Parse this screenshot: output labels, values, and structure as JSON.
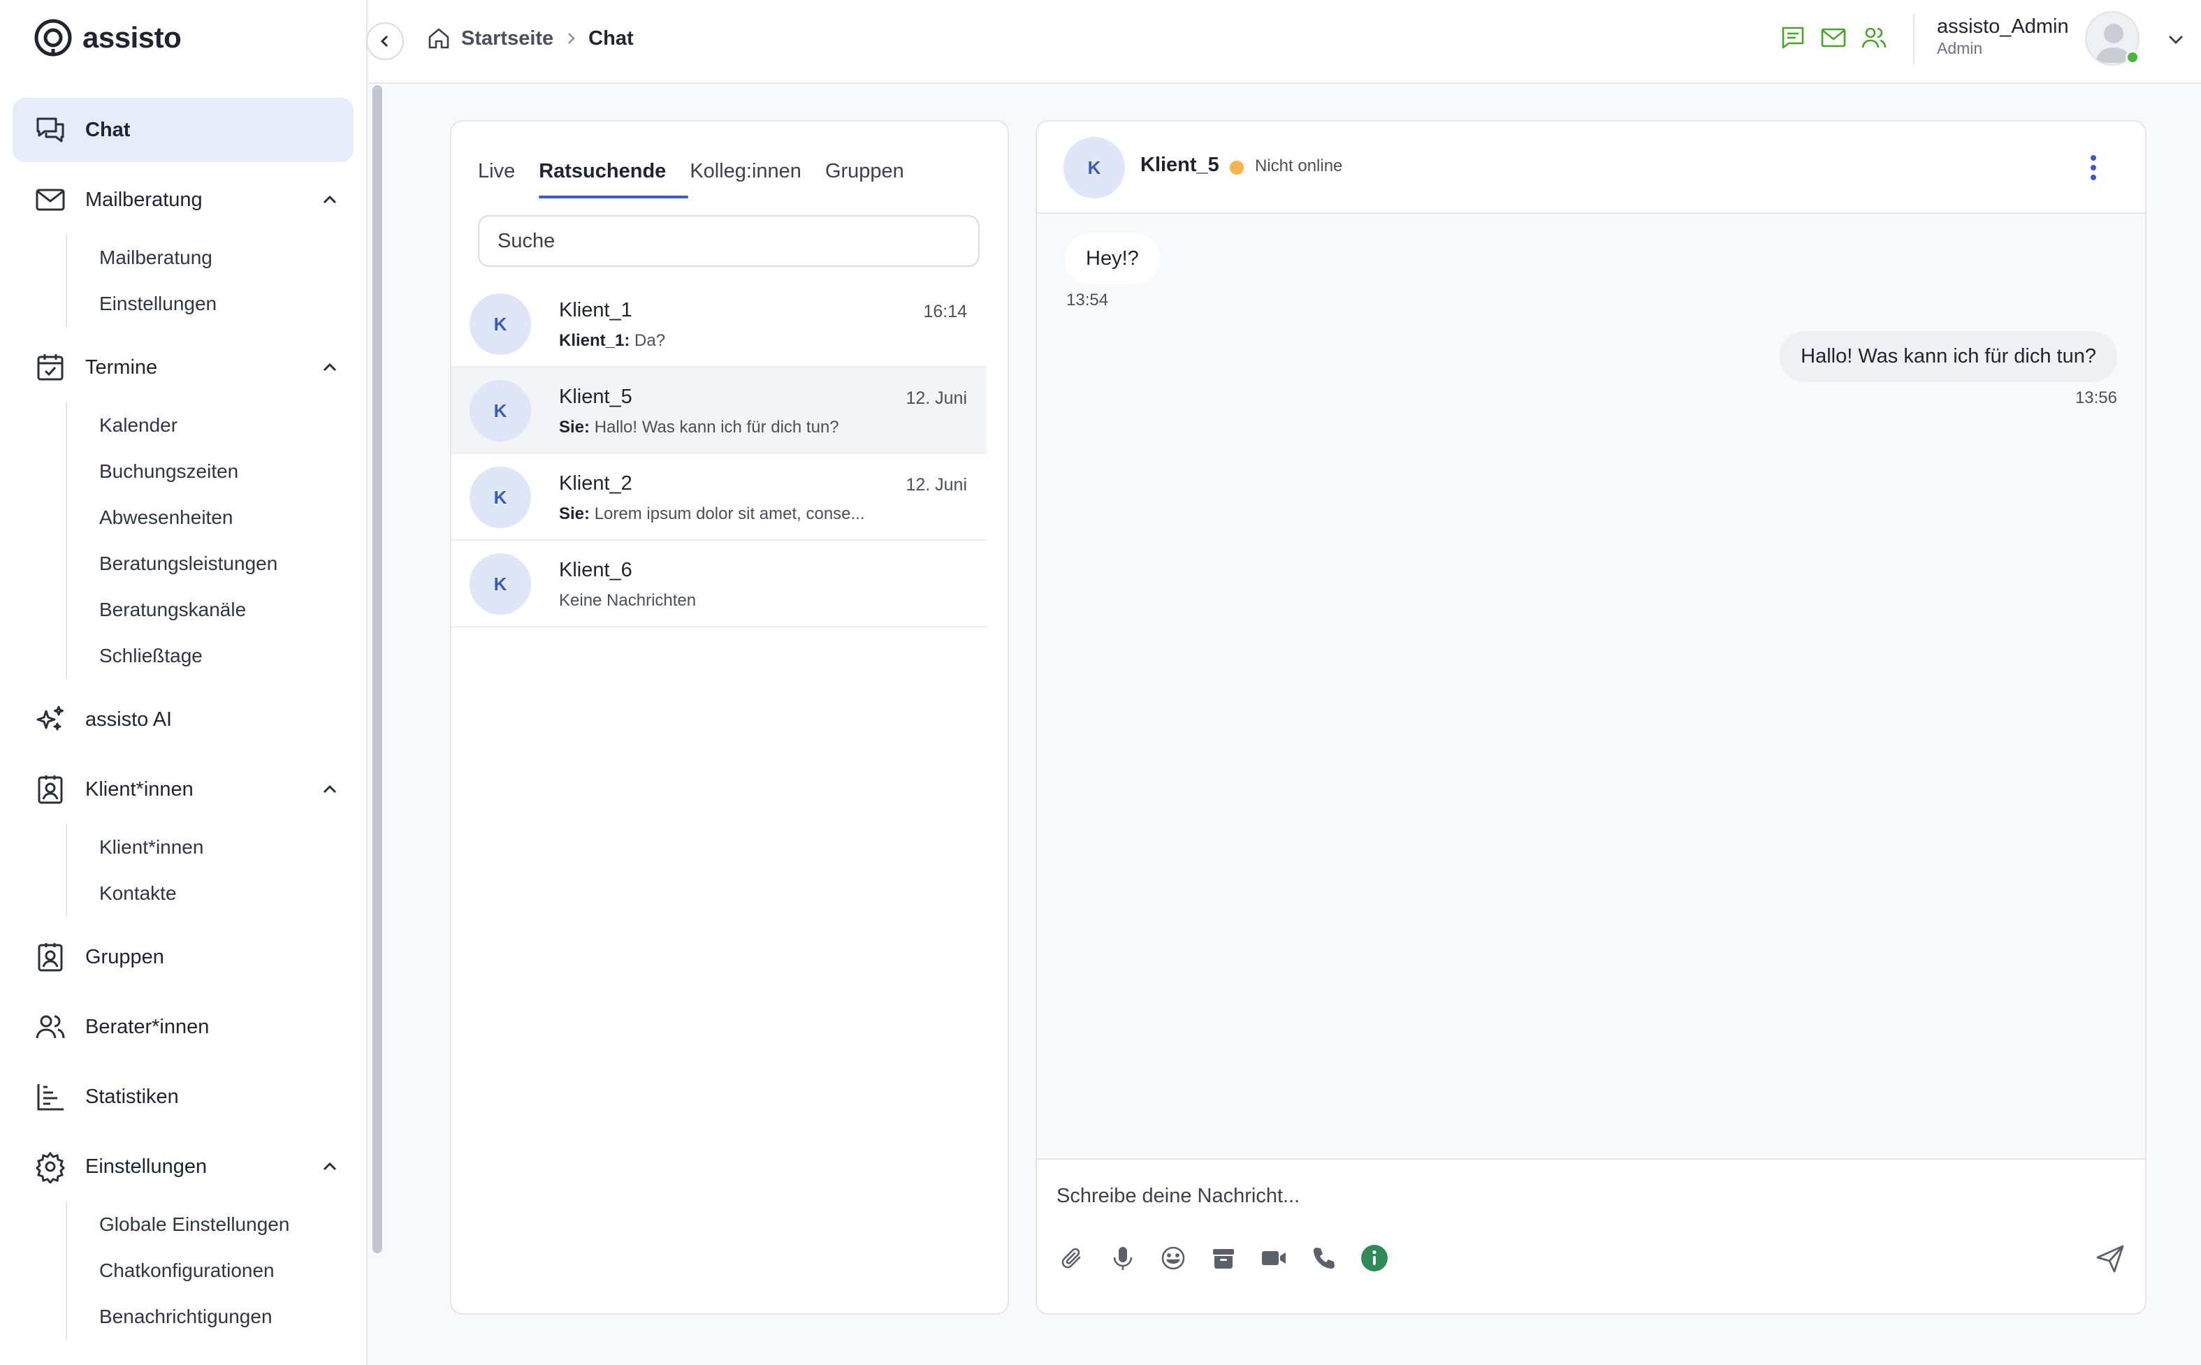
{
  "app": {
    "name": "assisto"
  },
  "sidebar": {
    "items": [
      {
        "label": "Chat",
        "icon": "chat-icon",
        "active": true
      },
      {
        "label": "Mailberatung",
        "icon": "mail-icon",
        "expanded": true,
        "children": [
          "Mailberatung",
          "Einstellungen"
        ]
      },
      {
        "label": "Termine",
        "icon": "calendar-icon",
        "expanded": true,
        "children": [
          "Kalender",
          "Buchungszeiten",
          "Abwesenheiten",
          "Beratungsleistungen",
          "Beratungskanäle",
          "Schließtage"
        ]
      },
      {
        "label": "assisto AI",
        "icon": "sparkles-icon"
      },
      {
        "label": "Klient*innen",
        "icon": "contact-card-icon",
        "expanded": true,
        "children": [
          "Klient*innen",
          "Kontakte"
        ]
      },
      {
        "label": "Gruppen",
        "icon": "group-card-icon"
      },
      {
        "label": "Berater*innen",
        "icon": "users-icon"
      },
      {
        "label": "Statistiken",
        "icon": "bar-chart-icon"
      },
      {
        "label": "Einstellungen",
        "icon": "gear-icon",
        "expanded": true,
        "children": [
          "Globale Einstellungen",
          "Chatkonfigurationen",
          "Benachrichtigungen"
        ]
      }
    ]
  },
  "header": {
    "breadcrumb": {
      "home": "Startseite",
      "current": "Chat"
    },
    "user": {
      "name": "assisto_Admin",
      "role": "Admin"
    },
    "accent": "#49a32b"
  },
  "chat_list": {
    "tabs": [
      "Live",
      "Ratsuchende",
      "Kolleg:innen",
      "Gruppen"
    ],
    "active_tab": "Ratsuchende",
    "search_placeholder": "Suche",
    "conversations": [
      {
        "initial": "K",
        "name": "Klient_1",
        "time": "16:14",
        "sender": "Klient_1:",
        "preview": "Da?"
      },
      {
        "initial": "K",
        "name": "Klient_5",
        "time": "12. Juni",
        "sender": "Sie:",
        "preview": "Hallo! Was kann ich für dich tun?",
        "selected": true
      },
      {
        "initial": "K",
        "name": "Klient_2",
        "time": "12. Juni",
        "sender": "Sie:",
        "preview": "Lorem ipsum dolor sit amet, conse..."
      },
      {
        "initial": "K",
        "name": "Klient_6",
        "time": "",
        "sender": "",
        "preview": "Keine Nachrichten"
      }
    ]
  },
  "conversation": {
    "initial": "K",
    "name": "Klient_5",
    "status": "Nicht online",
    "status_color": "#f5b54a",
    "messages": [
      {
        "direction": "in",
        "text": "Hey!?",
        "time": "13:54"
      },
      {
        "direction": "out",
        "text": "Hallo! Was kann ich für dich tun?",
        "time": "13:56"
      }
    ],
    "composer_placeholder": "Schreibe deine Nachricht...",
    "tools": [
      "paperclip-icon",
      "microphone-icon",
      "emoji-icon",
      "archive-icon",
      "video-icon",
      "phone-icon",
      "info-icon"
    ]
  }
}
